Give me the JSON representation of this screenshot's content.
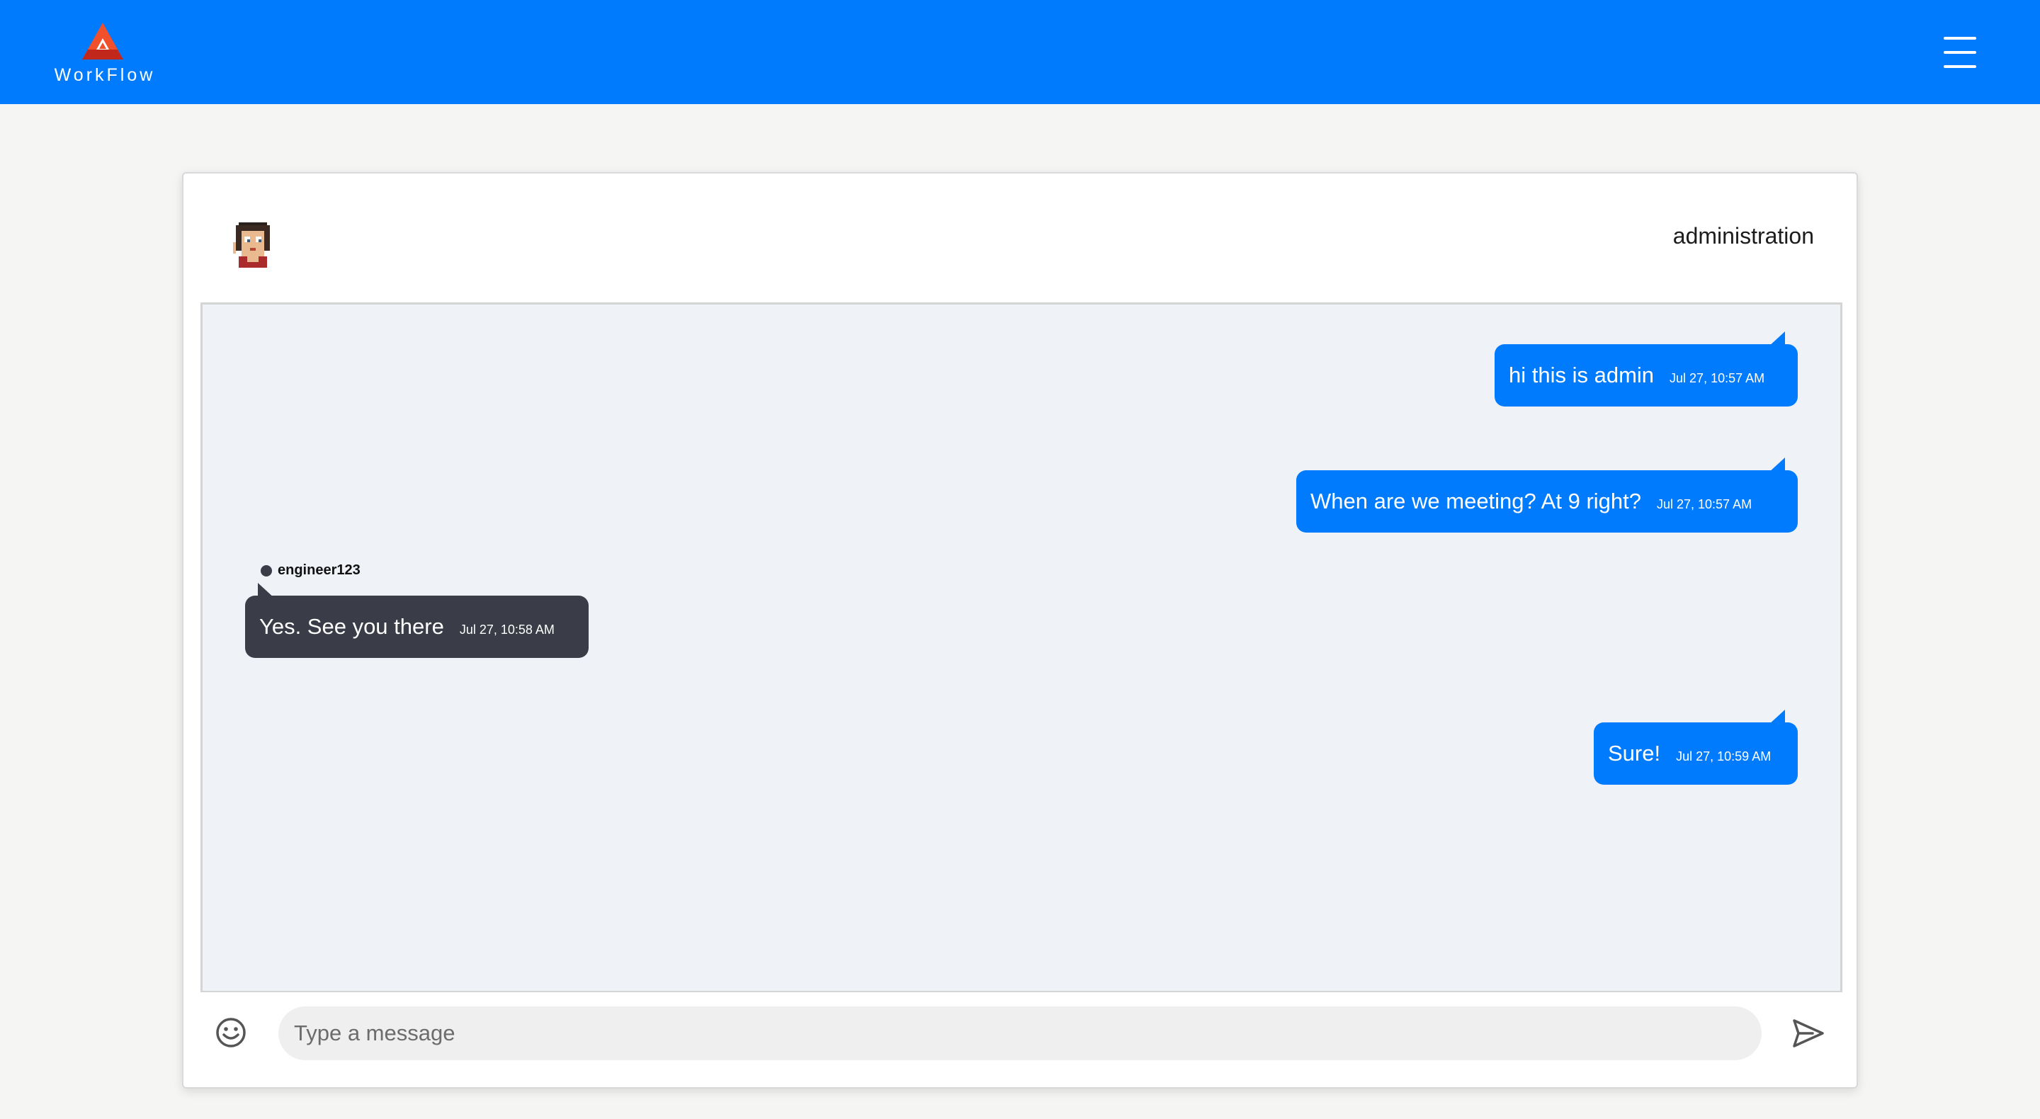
{
  "navbar": {
    "brand_name": "WorkFlow",
    "logo_icon": "workflow-triangle-logo",
    "menu_icon": "hamburger-menu-icon",
    "colors": {
      "bar": "#017bfe",
      "logo_top": "#f0502c",
      "logo_bottom": "#c1271a"
    }
  },
  "chat": {
    "name": "administration",
    "avatar_icon": "pixel-avatar",
    "messages": [
      {
        "direction": "outgoing",
        "text": "hi this is admin",
        "time": "Jul 27, 10:57 AM"
      },
      {
        "direction": "outgoing",
        "text": "When are we meeting? At 9 right?",
        "time": "Jul 27, 10:57 AM"
      },
      {
        "direction": "incoming",
        "sender": "engineer123",
        "text": "Yes. See you there",
        "time": "Jul 27, 10:58 AM"
      },
      {
        "direction": "outgoing",
        "text": "Sure!",
        "time": "Jul 27, 10:59 AM"
      }
    ],
    "colors": {
      "outgoing": "#017bfe",
      "incoming": "#3a3c47",
      "panel": "#eff3f8"
    }
  },
  "composer": {
    "placeholder": "Type a message",
    "value": "",
    "emoji_icon": "smiley-icon",
    "send_icon": "send-arrow-icon"
  }
}
